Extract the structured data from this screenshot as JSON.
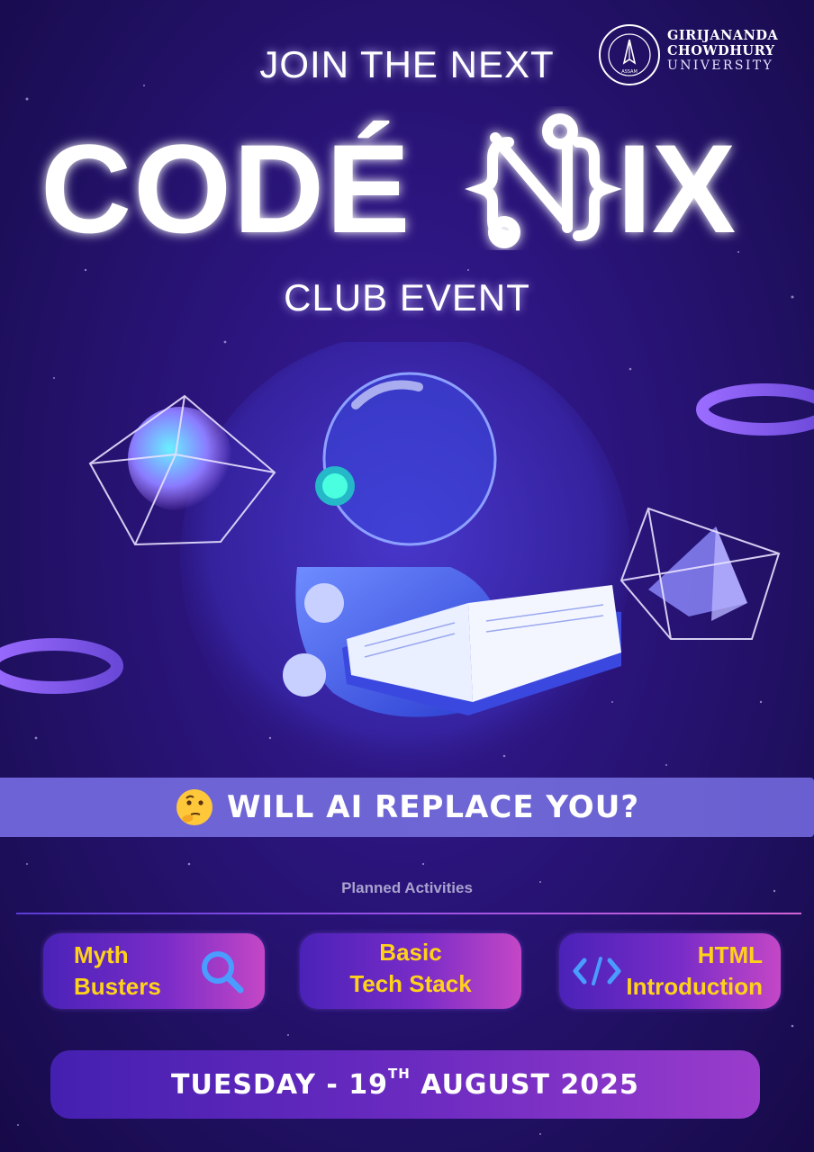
{
  "header": {
    "top_line": "JOIN THE NEXT",
    "brand": "CODÉNIX",
    "bottom_line": "CLUB EVENT"
  },
  "university": {
    "line1": "GIRIJANANDA",
    "line2": "CHOWDHURY",
    "line3": "UNIVERSITY",
    "seal_top": "GIRIJANANDA CHOWDHURY UNIVERSITY",
    "seal_bottom": "ASSAM"
  },
  "question": {
    "text": "WILL AI REPLACE YOU?",
    "icon": "thinking-face-emoji"
  },
  "activities": {
    "heading": "Planned Activities",
    "items": [
      {
        "line1": "Myth",
        "line2": "Busters",
        "icon": "magnifier-icon"
      },
      {
        "line1": "Basic",
        "line2": "Tech Stack",
        "icon": ""
      },
      {
        "line1": "HTML",
        "line2": "Introduction",
        "icon": "code-icon"
      }
    ]
  },
  "date": {
    "prefix": "TUESDAY - 19",
    "ordinal": "TH",
    "suffix": " AUGUST 2025"
  },
  "colors": {
    "background": "#24127a",
    "accent_yellow": "#ffd21a",
    "question_bar": "#6d62d6",
    "card_gradient_start": "#4a22b8",
    "card_gradient_end": "#c447c6"
  }
}
